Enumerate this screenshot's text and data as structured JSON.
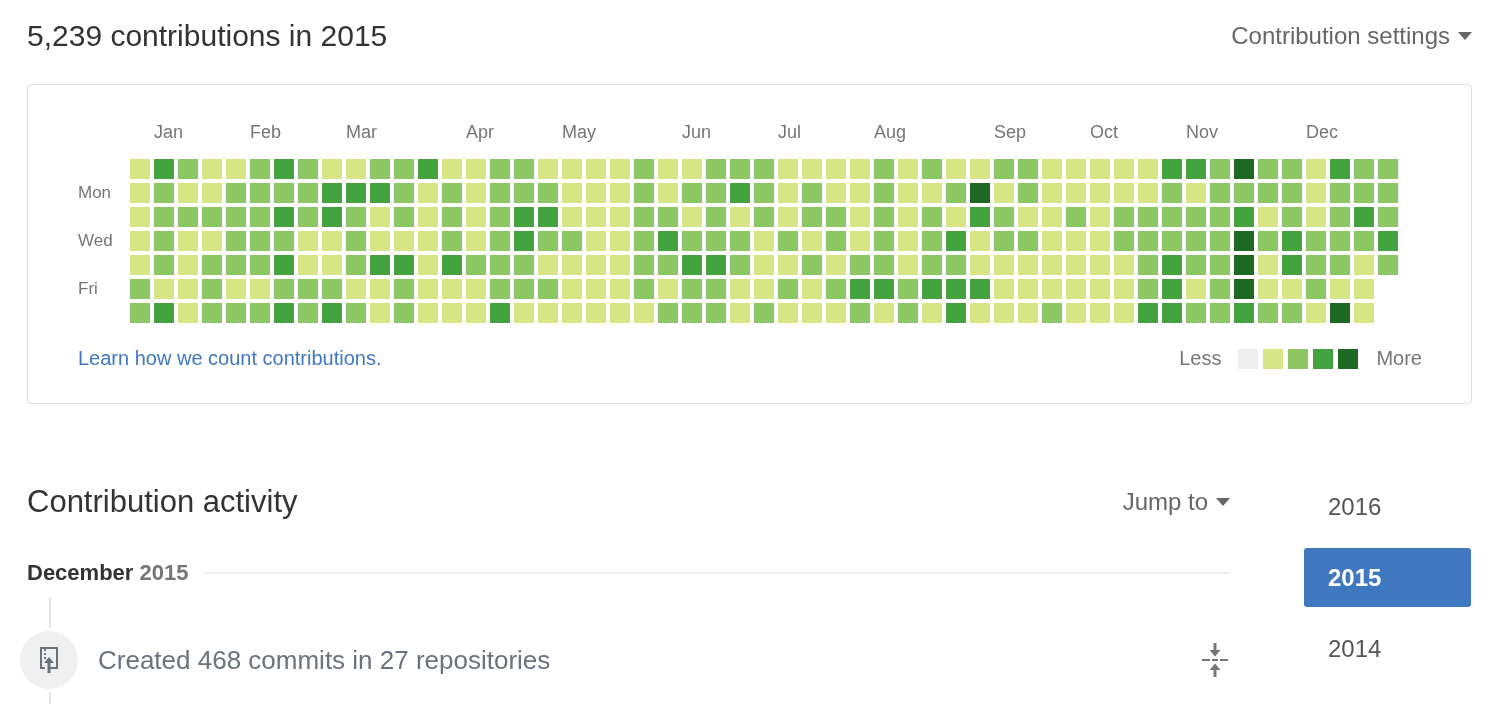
{
  "header": {
    "title": "5,239 contributions in 2015",
    "settings_label": "Contribution settings"
  },
  "calendar": {
    "months": [
      "Jan",
      "Feb",
      "Mar",
      "Apr",
      "May",
      "Jun",
      "Jul",
      "Aug",
      "Sep",
      "Oct",
      "Nov",
      "Dec"
    ],
    "rows": [
      {
        "cells": [
          {
            "color": "#d6e685"
          },
          {
            "color": "#44a340"
          },
          {
            "color": "#8cc665"
          },
          {
            "color": "#d6e685"
          },
          {
            "color": "#d6e685"
          },
          {
            "color": "#8cc665"
          },
          {
            "color": "#44a340"
          },
          {
            "color": "#8cc665"
          },
          {
            "color": "#d6e685"
          },
          {
            "color": "#d6e685"
          },
          {
            "color": "#8cc665"
          },
          {
            "color": "#8cc665"
          },
          {
            "color": "#44a340"
          },
          {
            "color": "#d6e685"
          },
          {
            "color": "#d6e685"
          },
          {
            "color": "#8cc665"
          },
          {
            "color": "#8cc665"
          },
          {
            "color": "#d6e685"
          },
          {
            "color": "#d6e685"
          },
          {
            "color": "#d6e685"
          },
          {
            "color": "#d6e685"
          },
          {
            "color": "#8cc665"
          },
          {
            "color": "#d6e685"
          },
          {
            "color": "#d6e685"
          },
          {
            "color": "#8cc665"
          },
          {
            "color": "#8cc665"
          },
          {
            "color": "#8cc665"
          },
          {
            "color": "#d6e685"
          },
          {
            "color": "#d6e685"
          },
          {
            "color": "#d6e685"
          },
          {
            "color": "#d6e685"
          },
          {
            "color": "#8cc665"
          },
          {
            "color": "#d6e685"
          },
          {
            "color": "#8cc665"
          },
          {
            "color": "#d6e685"
          },
          {
            "color": "#d6e685"
          },
          {
            "color": "#8cc665"
          },
          {
            "color": "#8cc665"
          },
          {
            "color": "#d6e685"
          },
          {
            "color": "#d6e685"
          },
          {
            "color": "#d6e685"
          },
          {
            "color": "#d6e685"
          },
          {
            "color": "#d6e685"
          },
          {
            "color": "#44a340"
          },
          {
            "color": "#44a340"
          },
          {
            "color": "#8cc665"
          },
          {
            "color": "#1e6823"
          },
          {
            "color": "#8cc665"
          },
          {
            "color": "#8cc665"
          },
          {
            "color": "#d6e685"
          },
          {
            "color": "#44a340"
          },
          {
            "color": "#8cc665"
          },
          {
            "color": "#8cc665"
          }
        ]
      },
      {
        "label": "Mon",
        "cells": [
          {
            "color": "#d6e685"
          },
          {
            "color": "#8cc665"
          },
          {
            "color": "#d6e685"
          },
          {
            "color": "#d6e685"
          },
          {
            "color": "#8cc665"
          },
          {
            "color": "#8cc665"
          },
          {
            "color": "#8cc665"
          },
          {
            "color": "#8cc665"
          },
          {
            "color": "#44a340"
          },
          {
            "color": "#44a340"
          },
          {
            "color": "#44a340"
          },
          {
            "color": "#8cc665"
          },
          {
            "color": "#d6e685"
          },
          {
            "color": "#8cc665"
          },
          {
            "color": "#d6e685"
          },
          {
            "color": "#8cc665"
          },
          {
            "color": "#8cc665"
          },
          {
            "color": "#8cc665"
          },
          {
            "color": "#d6e685"
          },
          {
            "color": "#d6e685"
          },
          {
            "color": "#d6e685"
          },
          {
            "color": "#8cc665"
          },
          {
            "color": "#d6e685"
          },
          {
            "color": "#8cc665"
          },
          {
            "color": "#8cc665"
          },
          {
            "color": "#44a340"
          },
          {
            "color": "#8cc665"
          },
          {
            "color": "#d6e685"
          },
          {
            "color": "#8cc665"
          },
          {
            "color": "#d6e685"
          },
          {
            "color": "#d6e685"
          },
          {
            "color": "#8cc665"
          },
          {
            "color": "#d6e685"
          },
          {
            "color": "#d6e685"
          },
          {
            "color": "#8cc665"
          },
          {
            "color": "#1e6823"
          },
          {
            "color": "#d6e685"
          },
          {
            "color": "#8cc665"
          },
          {
            "color": "#d6e685"
          },
          {
            "color": "#d6e685"
          },
          {
            "color": "#d6e685"
          },
          {
            "color": "#d6e685"
          },
          {
            "color": "#d6e685"
          },
          {
            "color": "#8cc665"
          },
          {
            "color": "#d6e685"
          },
          {
            "color": "#8cc665"
          },
          {
            "color": "#8cc665"
          },
          {
            "color": "#8cc665"
          },
          {
            "color": "#8cc665"
          },
          {
            "color": "#d6e685"
          },
          {
            "color": "#8cc665"
          },
          {
            "color": "#8cc665"
          },
          {
            "color": "#8cc665"
          }
        ]
      },
      {
        "cells": [
          {
            "color": "#d6e685"
          },
          {
            "color": "#8cc665"
          },
          {
            "color": "#8cc665"
          },
          {
            "color": "#8cc665"
          },
          {
            "color": "#8cc665"
          },
          {
            "color": "#8cc665"
          },
          {
            "color": "#44a340"
          },
          {
            "color": "#8cc665"
          },
          {
            "color": "#44a340"
          },
          {
            "color": "#8cc665"
          },
          {
            "color": "#d6e685"
          },
          {
            "color": "#8cc665"
          },
          {
            "color": "#d6e685"
          },
          {
            "color": "#8cc665"
          },
          {
            "color": "#d6e685"
          },
          {
            "color": "#8cc665"
          },
          {
            "color": "#44a340"
          },
          {
            "color": "#44a340"
          },
          {
            "color": "#d6e685"
          },
          {
            "color": "#d6e685"
          },
          {
            "color": "#d6e685"
          },
          {
            "color": "#8cc665"
          },
          {
            "color": "#8cc665"
          },
          {
            "color": "#d6e685"
          },
          {
            "color": "#8cc665"
          },
          {
            "color": "#d6e685"
          },
          {
            "color": "#8cc665"
          },
          {
            "color": "#d6e685"
          },
          {
            "color": "#8cc665"
          },
          {
            "color": "#8cc665"
          },
          {
            "color": "#d6e685"
          },
          {
            "color": "#8cc665"
          },
          {
            "color": "#d6e685"
          },
          {
            "color": "#8cc665"
          },
          {
            "color": "#d6e685"
          },
          {
            "color": "#44a340"
          },
          {
            "color": "#8cc665"
          },
          {
            "color": "#d6e685"
          },
          {
            "color": "#d6e685"
          },
          {
            "color": "#8cc665"
          },
          {
            "color": "#d6e685"
          },
          {
            "color": "#8cc665"
          },
          {
            "color": "#8cc665"
          },
          {
            "color": "#8cc665"
          },
          {
            "color": "#8cc665"
          },
          {
            "color": "#8cc665"
          },
          {
            "color": "#44a340"
          },
          {
            "color": "#d6e685"
          },
          {
            "color": "#8cc665"
          },
          {
            "color": "#d6e685"
          },
          {
            "color": "#8cc665"
          },
          {
            "color": "#44a340"
          },
          {
            "color": "#8cc665"
          }
        ]
      },
      {
        "label": "Wed",
        "cells": [
          {
            "color": "#d6e685"
          },
          {
            "color": "#8cc665"
          },
          {
            "color": "#d6e685"
          },
          {
            "color": "#d6e685"
          },
          {
            "color": "#8cc665"
          },
          {
            "color": "#8cc665"
          },
          {
            "color": "#8cc665"
          },
          {
            "color": "#d6e685"
          },
          {
            "color": "#d6e685"
          },
          {
            "color": "#8cc665"
          },
          {
            "color": "#d6e685"
          },
          {
            "color": "#d6e685"
          },
          {
            "color": "#d6e685"
          },
          {
            "color": "#8cc665"
          },
          {
            "color": "#d6e685"
          },
          {
            "color": "#8cc665"
          },
          {
            "color": "#44a340"
          },
          {
            "color": "#8cc665"
          },
          {
            "color": "#8cc665"
          },
          {
            "color": "#d6e685"
          },
          {
            "color": "#d6e685"
          },
          {
            "color": "#8cc665"
          },
          {
            "color": "#44a340"
          },
          {
            "color": "#8cc665"
          },
          {
            "color": "#8cc665"
          },
          {
            "color": "#8cc665"
          },
          {
            "color": "#d6e685"
          },
          {
            "color": "#8cc665"
          },
          {
            "color": "#d6e685"
          },
          {
            "color": "#8cc665"
          },
          {
            "color": "#d6e685"
          },
          {
            "color": "#8cc665"
          },
          {
            "color": "#d6e685"
          },
          {
            "color": "#8cc665"
          },
          {
            "color": "#44a340"
          },
          {
            "color": "#d6e685"
          },
          {
            "color": "#8cc665"
          },
          {
            "color": "#8cc665"
          },
          {
            "color": "#d6e685"
          },
          {
            "color": "#d6e685"
          },
          {
            "color": "#d6e685"
          },
          {
            "color": "#8cc665"
          },
          {
            "color": "#8cc665"
          },
          {
            "color": "#8cc665"
          },
          {
            "color": "#8cc665"
          },
          {
            "color": "#8cc665"
          },
          {
            "color": "#1e6823"
          },
          {
            "color": "#8cc665"
          },
          {
            "color": "#44a340"
          },
          {
            "color": "#8cc665"
          },
          {
            "color": "#8cc665"
          },
          {
            "color": "#8cc665"
          },
          {
            "color": "#44a340"
          }
        ]
      },
      {
        "cells": [
          {
            "color": "#d6e685"
          },
          {
            "color": "#8cc665"
          },
          {
            "color": "#d6e685"
          },
          {
            "color": "#8cc665"
          },
          {
            "color": "#8cc665"
          },
          {
            "color": "#8cc665"
          },
          {
            "color": "#44a340"
          },
          {
            "color": "#d6e685"
          },
          {
            "color": "#d6e685"
          },
          {
            "color": "#8cc665"
          },
          {
            "color": "#44a340"
          },
          {
            "color": "#44a340"
          },
          {
            "color": "#d6e685"
          },
          {
            "color": "#44a340"
          },
          {
            "color": "#8cc665"
          },
          {
            "color": "#8cc665"
          },
          {
            "color": "#8cc665"
          },
          {
            "color": "#d6e685"
          },
          {
            "color": "#d6e685"
          },
          {
            "color": "#d6e685"
          },
          {
            "color": "#d6e685"
          },
          {
            "color": "#8cc665"
          },
          {
            "color": "#8cc665"
          },
          {
            "color": "#44a340"
          },
          {
            "color": "#44a340"
          },
          {
            "color": "#8cc665"
          },
          {
            "color": "#d6e685"
          },
          {
            "color": "#d6e685"
          },
          {
            "color": "#8cc665"
          },
          {
            "color": "#d6e685"
          },
          {
            "color": "#8cc665"
          },
          {
            "color": "#8cc665"
          },
          {
            "color": "#d6e685"
          },
          {
            "color": "#8cc665"
          },
          {
            "color": "#8cc665"
          },
          {
            "color": "#d6e685"
          },
          {
            "color": "#d6e685"
          },
          {
            "color": "#d6e685"
          },
          {
            "color": "#d6e685"
          },
          {
            "color": "#d6e685"
          },
          {
            "color": "#d6e685"
          },
          {
            "color": "#d6e685"
          },
          {
            "color": "#8cc665"
          },
          {
            "color": "#44a340"
          },
          {
            "color": "#8cc665"
          },
          {
            "color": "#8cc665"
          },
          {
            "color": "#1e6823"
          },
          {
            "color": "#d6e685"
          },
          {
            "color": "#44a340"
          },
          {
            "color": "#8cc665"
          },
          {
            "color": "#8cc665"
          },
          {
            "color": "#d6e685"
          },
          {
            "color": "#8cc665"
          }
        ]
      },
      {
        "label": "Fri",
        "cells": [
          {
            "color": "#8cc665"
          },
          {
            "color": "#d6e685"
          },
          {
            "color": "#d6e685"
          },
          {
            "color": "#8cc665"
          },
          {
            "color": "#d6e685"
          },
          {
            "color": "#d6e685"
          },
          {
            "color": "#8cc665"
          },
          {
            "color": "#8cc665"
          },
          {
            "color": "#8cc665"
          },
          {
            "color": "#d6e685"
          },
          {
            "color": "#d6e685"
          },
          {
            "color": "#8cc665"
          },
          {
            "color": "#d6e685"
          },
          {
            "color": "#d6e685"
          },
          {
            "color": "#d6e685"
          },
          {
            "color": "#8cc665"
          },
          {
            "color": "#8cc665"
          },
          {
            "color": "#8cc665"
          },
          {
            "color": "#d6e685"
          },
          {
            "color": "#d6e685"
          },
          {
            "color": "#d6e685"
          },
          {
            "color": "#8cc665"
          },
          {
            "color": "#d6e685"
          },
          {
            "color": "#8cc665"
          },
          {
            "color": "#8cc665"
          },
          {
            "color": "#d6e685"
          },
          {
            "color": "#d6e685"
          },
          {
            "color": "#8cc665"
          },
          {
            "color": "#d6e685"
          },
          {
            "color": "#8cc665"
          },
          {
            "color": "#44a340"
          },
          {
            "color": "#44a340"
          },
          {
            "color": "#8cc665"
          },
          {
            "color": "#44a340"
          },
          {
            "color": "#44a340"
          },
          {
            "color": "#44a340"
          },
          {
            "color": "#d6e685"
          },
          {
            "color": "#d6e685"
          },
          {
            "color": "#d6e685"
          },
          {
            "color": "#d6e685"
          },
          {
            "color": "#d6e685"
          },
          {
            "color": "#d6e685"
          },
          {
            "color": "#8cc665"
          },
          {
            "color": "#44a340"
          },
          {
            "color": "#d6e685"
          },
          {
            "color": "#8cc665"
          },
          {
            "color": "#1e6823"
          },
          {
            "color": "#d6e685"
          },
          {
            "color": "#d6e685"
          },
          {
            "color": "#8cc665"
          },
          {
            "color": "#d6e685"
          },
          {
            "color": "#d6e685"
          }
        ]
      },
      {
        "cells": [
          {
            "color": "#8cc665"
          },
          {
            "color": "#44a340"
          },
          {
            "color": "#d6e685"
          },
          {
            "color": "#8cc665"
          },
          {
            "color": "#8cc665"
          },
          {
            "color": "#8cc665"
          },
          {
            "color": "#44a340"
          },
          {
            "color": "#8cc665"
          },
          {
            "color": "#44a340"
          },
          {
            "color": "#8cc665"
          },
          {
            "color": "#d6e685"
          },
          {
            "color": "#8cc665"
          },
          {
            "color": "#d6e685"
          },
          {
            "color": "#d6e685"
          },
          {
            "color": "#d6e685"
          },
          {
            "color": "#44a340"
          },
          {
            "color": "#d6e685"
          },
          {
            "color": "#d6e685"
          },
          {
            "color": "#d6e685"
          },
          {
            "color": "#d6e685"
          },
          {
            "color": "#d6e685"
          },
          {
            "color": "#d6e685"
          },
          {
            "color": "#8cc665"
          },
          {
            "color": "#8cc665"
          },
          {
            "color": "#8cc665"
          },
          {
            "color": "#d6e685"
          },
          {
            "color": "#8cc665"
          },
          {
            "color": "#d6e685"
          },
          {
            "color": "#d6e685"
          },
          {
            "color": "#d6e685"
          },
          {
            "color": "#8cc665"
          },
          {
            "color": "#d6e685"
          },
          {
            "color": "#8cc665"
          },
          {
            "color": "#d6e685"
          },
          {
            "color": "#44a340"
          },
          {
            "color": "#d6e685"
          },
          {
            "color": "#d6e685"
          },
          {
            "color": "#d6e685"
          },
          {
            "color": "#8cc665"
          },
          {
            "color": "#d6e685"
          },
          {
            "color": "#d6e685"
          },
          {
            "color": "#d6e685"
          },
          {
            "color": "#44a340"
          },
          {
            "color": "#44a340"
          },
          {
            "color": "#8cc665"
          },
          {
            "color": "#8cc665"
          },
          {
            "color": "#44a340"
          },
          {
            "color": "#8cc665"
          },
          {
            "color": "#8cc665"
          },
          {
            "color": "#d6e685"
          },
          {
            "color": "#1e6823"
          },
          {
            "color": "#d6e685"
          }
        ]
      }
    ],
    "learn_link": "Learn how we count contributions.",
    "legend": {
      "less": "Less",
      "swatches": [
        {
          "color": "#eeeeee"
        },
        {
          "color": "#d6e685"
        },
        {
          "color": "#8cc665"
        },
        {
          "color": "#44a340"
        },
        {
          "color": "#1e6823"
        }
      ],
      "more": "More"
    }
  },
  "activity": {
    "title": "Contribution activity",
    "jump_label": "Jump to",
    "month_heading": {
      "month": "December",
      "year": "2015"
    },
    "items": [
      {
        "summary": "Created 468 commits in 27 repositories"
      }
    ]
  },
  "years": [
    {
      "label": "2016",
      "selected": false
    },
    {
      "label": "2015",
      "selected": true
    },
    {
      "label": "2014",
      "selected": false
    }
  ]
}
